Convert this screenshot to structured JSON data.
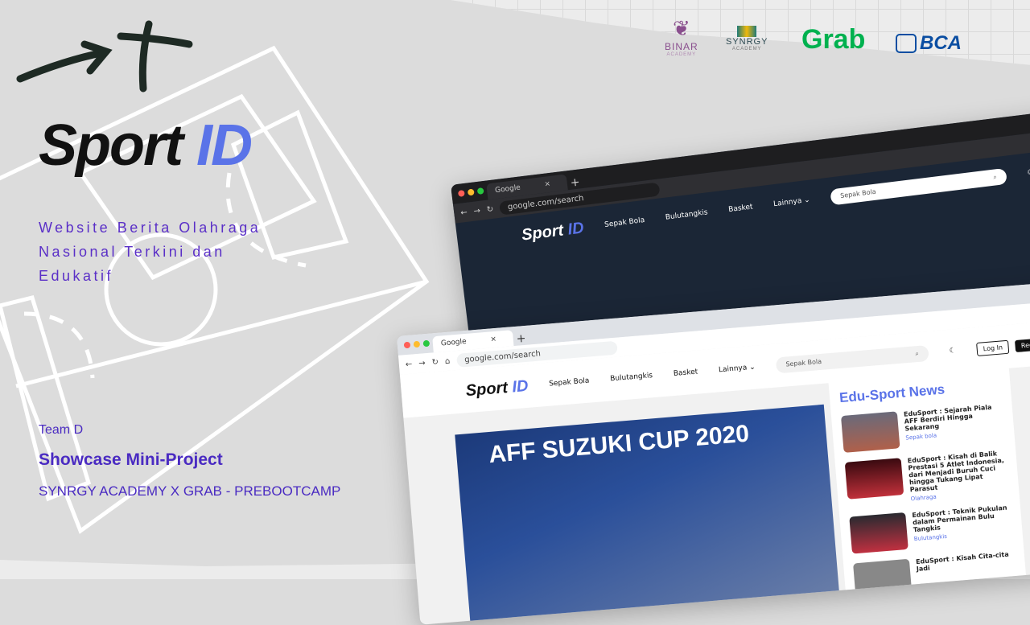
{
  "title": {
    "main": "Sport",
    "accent": "ID"
  },
  "tagline": [
    "Website Berita Olahraga",
    "Nasional Terkini dan",
    "Edukatif"
  ],
  "team": "Team D",
  "showcase": "Showcase Mini-Project",
  "academy": "SYNRGY ACADEMY X GRAB - PREBOOTCAMP",
  "sponsors": {
    "binar": "BINAR",
    "binar_sub": "ACADEMY",
    "synrgy": "SYNRGY",
    "synrgy_sub": "ACADEMY",
    "grab": "Grab",
    "bca": "BCA"
  },
  "browser": {
    "tab": "Google",
    "url": "google.com/search",
    "close": "×",
    "new_tab": "+"
  },
  "site": {
    "logo_main": "Sport",
    "logo_accent": "ID",
    "nav": [
      "Sepak Bola",
      "Bulutangkis",
      "Basket",
      "Lainnya ⌄"
    ],
    "search": "Sepak Bola",
    "login": "Log In",
    "register": "Register",
    "hero": "AFF SUZUKI CUP 2020"
  },
  "sidebar": {
    "title": "Edu-Sport News",
    "items": [
      {
        "title": "EduSport : Sejarah Piala AFF Berdiri Hingga Sekarang",
        "cat": "Sepak bola"
      },
      {
        "title": "EduSport : Kisah di Balik Prestasi 5 Atlet Indonesia, dari Menjadi Buruh Cuci hingga Tukang Lipat Parasut",
        "cat": "Olahraga"
      },
      {
        "title": "EduSport : Teknik Pukulan dalam Permainan Bulu Tangkis",
        "cat": "Bulutangkis"
      },
      {
        "title": "EduSport : Kisah Cita-cita Jadi",
        "cat": ""
      }
    ]
  },
  "colors": {
    "accent": "#5a73e8",
    "purple": "#4a2bc2",
    "grab": "#00b14f",
    "bca": "#0b4ea2"
  }
}
